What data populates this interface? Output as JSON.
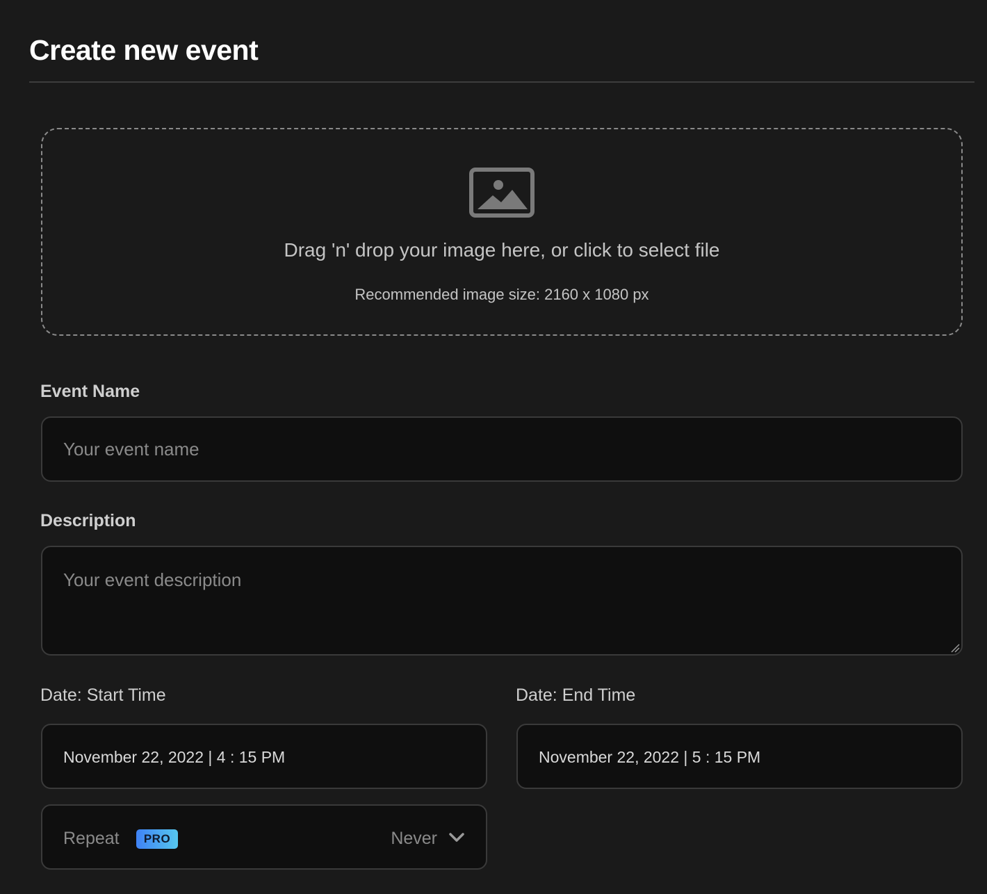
{
  "page": {
    "title": "Create new event"
  },
  "upload": {
    "title": "Drag 'n' drop your image here, or click to select file",
    "hint": "Recommended image size: 2160 x 1080 px",
    "icon": "image-icon"
  },
  "event_name": {
    "label": "Event Name",
    "placeholder": "Your event name",
    "value": ""
  },
  "description": {
    "label": "Description",
    "placeholder": "Your event description",
    "value": ""
  },
  "start_time": {
    "label": "Date: Start Time",
    "value": "November 22, 2022 | 4 : 15 PM"
  },
  "end_time": {
    "label": "Date: End Time",
    "value": "November 22, 2022 | 5 : 15 PM"
  },
  "repeat": {
    "label": "Repeat",
    "badge": "PRO",
    "value": "Never",
    "icon": "chevron-down-icon"
  },
  "colors": {
    "background": "#1a1a1a",
    "input_background": "#0f0f0f",
    "badge_gradient_start": "#3f82f5",
    "badge_gradient_end": "#56c7ee"
  }
}
